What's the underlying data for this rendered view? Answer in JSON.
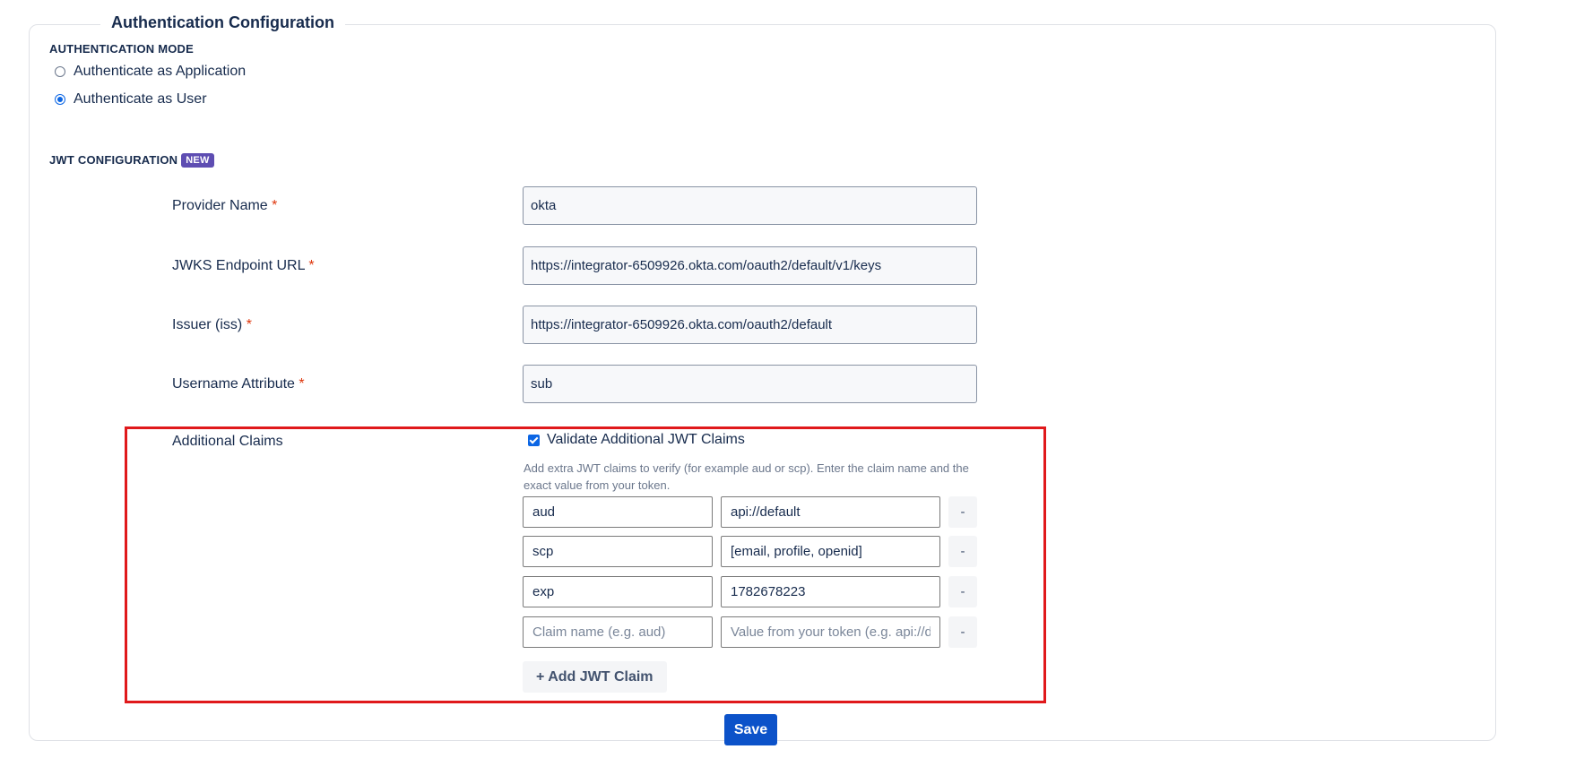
{
  "config": {
    "title": "Authentication Configuration",
    "auth_mode": {
      "heading": "AUTHENTICATION MODE",
      "options": [
        {
          "label": "Authenticate as Application",
          "selected": false
        },
        {
          "label": "Authenticate as User",
          "selected": true
        }
      ]
    },
    "jwt": {
      "heading": "JWT CONFIGURATION",
      "badge": "NEW",
      "fields": [
        {
          "label": "Provider Name",
          "required": "*",
          "value": "okta"
        },
        {
          "label": "JWKS Endpoint URL",
          "required": "*",
          "value": "https://integrator-6509926.okta.com/oauth2/default/v1/keys"
        },
        {
          "label": "Issuer (iss)",
          "required": "*",
          "value": "https://integrator-6509926.okta.com/oauth2/default"
        },
        {
          "label": "Username Attribute",
          "required": "*",
          "value": "sub"
        }
      ],
      "additional_claims": {
        "label": "Additional Claims",
        "checkbox_label": "Validate Additional JWT Claims",
        "checkbox_checked": true,
        "help_text": "Add extra JWT claims to verify (for example aud or scp). Enter the claim name and the exact value from your token.",
        "claims": [
          {
            "name": "aud",
            "value": "api://default"
          },
          {
            "name": "scp",
            "value": "[email, profile, openid]"
          },
          {
            "name": "exp",
            "value": "1782678223"
          },
          {
            "name": "",
            "value": "",
            "name_placeholder": "Claim name (e.g. aud)",
            "value_placeholder": "Value from your token (e.g. api://default)"
          }
        ],
        "remove_label": "-",
        "add_label": "+ Add JWT Claim"
      }
    },
    "save_label": "Save"
  },
  "colors": {
    "accent": "#0c66e4",
    "save_button": "#0c52c9",
    "badge": "#5e4db2",
    "required": "#de350b",
    "highlight": "#e0191c"
  }
}
